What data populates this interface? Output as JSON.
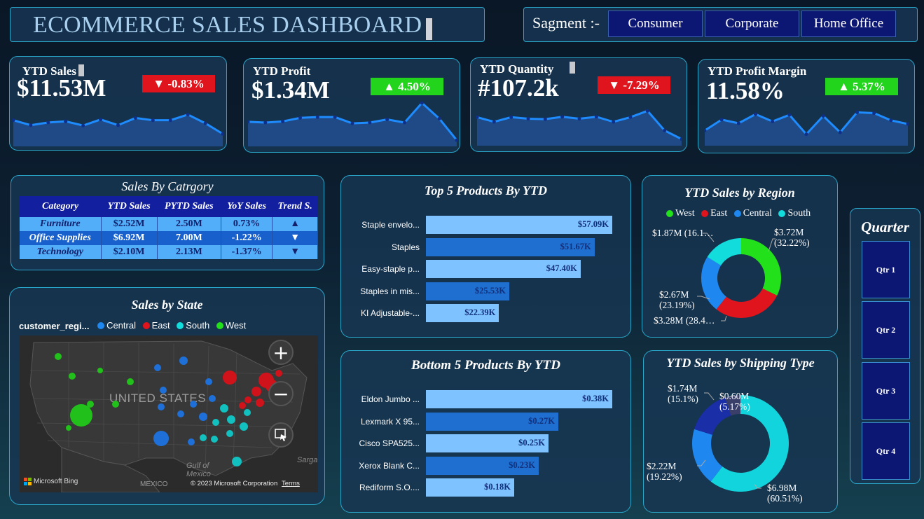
{
  "header": {
    "title": "ECOMMERCE SALES DASHBOARD"
  },
  "segment": {
    "label": "Sagment :-",
    "options": [
      "Consumer",
      "Corporate",
      "Home Office"
    ]
  },
  "kpis": [
    {
      "label": "YTD Sales",
      "value": "$11.53M",
      "change": "▼ -0.83%",
      "trend": "down",
      "spark": [
        0.58,
        0.45,
        0.52,
        0.55,
        0.44,
        0.6,
        0.45,
        0.64,
        0.58,
        0.58,
        0.73,
        0.5,
        0.22
      ]
    },
    {
      "label": "YTD Profit",
      "value": "$1.34M",
      "change": "▲  4.50%",
      "trend": "up",
      "spark": [
        0.52,
        0.5,
        0.53,
        0.62,
        0.64,
        0.64,
        0.48,
        0.5,
        0.58,
        0.5,
        1.0,
        0.6,
        0.05
      ]
    },
    {
      "label": "YTD Quantity",
      "value": "#107.2k",
      "change": "▼ -7.29%",
      "trend": "down",
      "spark": [
        0.62,
        0.5,
        0.62,
        0.58,
        0.57,
        0.63,
        0.58,
        0.63,
        0.5,
        0.62,
        0.78,
        0.28,
        0.06
      ]
    },
    {
      "label": "YTD Profit Margin",
      "value": "11.58%",
      "change": "▲  5.37%",
      "trend": "up",
      "spark": [
        0.3,
        0.6,
        0.5,
        0.75,
        0.55,
        0.73,
        0.2,
        0.7,
        0.25,
        0.8,
        0.78,
        0.58,
        0.48
      ]
    }
  ],
  "sales_by_category": {
    "title": "Sales By Catrgory",
    "headers": [
      "Category",
      "YTD Sales",
      "PYTD Sales",
      "YoY Sales",
      "Trend S."
    ],
    "rows": [
      {
        "category": "Furniture",
        "ytd": "$2.52M",
        "pytd": "2.50M",
        "yoy": "0.73%",
        "trend": "▲",
        "dir": "up"
      },
      {
        "category": "Office Supplies",
        "ytd": "$6.92M",
        "pytd": "7.00M",
        "yoy": "-1.22%",
        "trend": "▼",
        "dir": "down"
      },
      {
        "category": "Technology",
        "ytd": "$2.10M",
        "pytd": "2.13M",
        "yoy": "-1.37%",
        "trend": "▼",
        "dir": "down"
      }
    ]
  },
  "top5": {
    "title": "Top 5 Products By YTD",
    "items": [
      {
        "name": "Staple envelo...",
        "value": 57.09,
        "label": "$57.09K"
      },
      {
        "name": "Staples",
        "value": 51.67,
        "label": "$51.67K"
      },
      {
        "name": "Easy-staple p...",
        "value": 47.4,
        "label": "$47.40K"
      },
      {
        "name": "Staples in mis...",
        "value": 25.53,
        "label": "$25.53K"
      },
      {
        "name": "KI Adjustable-...",
        "value": 22.39,
        "label": "$22.39K"
      }
    ]
  },
  "bottom5": {
    "title": "Bottom 5 Products By YTD",
    "items": [
      {
        "name": "Eldon Jumbo ...",
        "value": 0.38,
        "label": "$0.38K"
      },
      {
        "name": "Lexmark X 95...",
        "value": 0.27,
        "label": "$0.27K"
      },
      {
        "name": "Cisco SPA525...",
        "value": 0.25,
        "label": "$0.25K"
      },
      {
        "name": "Xerox Blank C...",
        "value": 0.23,
        "label": "$0.23K"
      },
      {
        "name": "Rediform S.O....",
        "value": 0.18,
        "label": "$0.18K"
      }
    ]
  },
  "region": {
    "title": "YTD Sales by Region",
    "legend": [
      {
        "name": "West",
        "color": "#22e01a"
      },
      {
        "name": "East",
        "color": "#e0141c"
      },
      {
        "name": "Central",
        "color": "#1e88f0"
      },
      {
        "name": "South",
        "color": "#12dcdc"
      }
    ],
    "slices": [
      {
        "name": "West",
        "value": 32.22,
        "color": "#22e01a",
        "label1": "$3.72M",
        "label2": "(32.22%)"
      },
      {
        "name": "East",
        "value": 28.46,
        "color": "#e0141c",
        "label1": "$3.28M (28.4…",
        "label2": ""
      },
      {
        "name": "Central",
        "value": 23.19,
        "color": "#1e88f0",
        "label1": "$2.67M",
        "label2": "(23.19%)"
      },
      {
        "name": "South",
        "value": 16.13,
        "color": "#12dcdc",
        "label1": "$1.87M (16.1…",
        "label2": ""
      }
    ]
  },
  "shipping": {
    "title": "YTD Sales by Shipping Type",
    "slices": [
      {
        "value": 60.51,
        "color": "#12d4dc",
        "label1": "$6.98M",
        "label2": "(60.51%)"
      },
      {
        "value": 19.22,
        "color": "#1e88f0",
        "label1": "$2.22M",
        "label2": "(19.22%)"
      },
      {
        "value": 15.1,
        "color": "#1a2ea8",
        "label1": "$1.74M",
        "label2": "(15.1%)"
      },
      {
        "value": 5.17,
        "color": "#3a3f6a",
        "label1": "$0.60M",
        "label2": "(5.17%)"
      }
    ]
  },
  "state_map": {
    "title": "Sales by State",
    "legend_title": "customer_regi...",
    "legend": [
      {
        "name": "Central",
        "color": "#1e88f0"
      },
      {
        "name": "East",
        "color": "#e0141c"
      },
      {
        "name": "South",
        "color": "#12dcdc"
      },
      {
        "name": "West",
        "color": "#22e01a"
      }
    ],
    "country_label": "UNITED STATES",
    "gulf_label": "Gulf of Mexico",
    "mexico_label": "MEXICO",
    "sargasso_label": "Sarga",
    "bing_label": "Microsoft Bing",
    "copyright": "© 2023 Microsoft Corporation",
    "terms": "Terms",
    "zoom_in": "+",
    "zoom_out": "−"
  },
  "quarter": {
    "title": "Quarter",
    "options": [
      "Qtr 1",
      "Qtr 2",
      "Qtr 3",
      "Qtr 4"
    ]
  }
}
